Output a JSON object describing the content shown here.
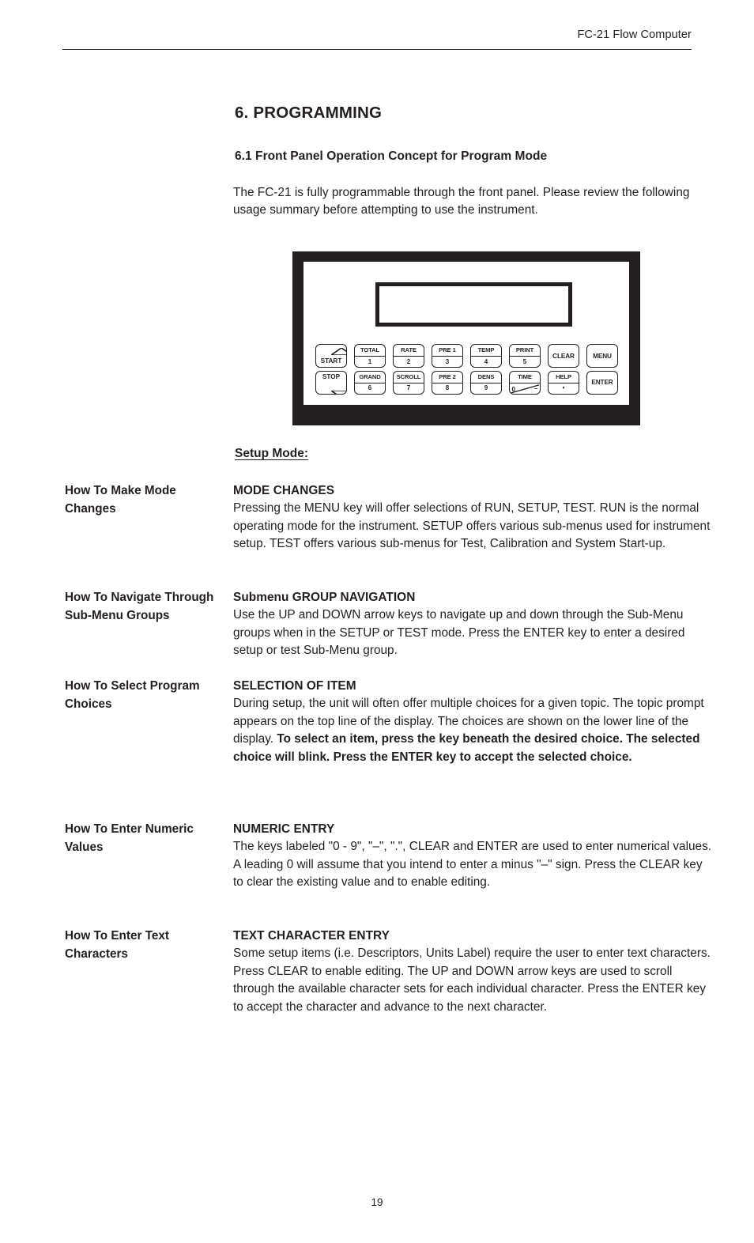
{
  "header": {
    "title": "FC-21 Flow Computer"
  },
  "titles": {
    "chapter": "6. PROGRAMMING",
    "section": "6.1 Front Panel Operation Concept for Program Mode",
    "intro": "The FC-21 is fully programmable through the front panel.  Please review the following usage summary before attempting to use  the instrument.",
    "setup_mode": "Setup Mode:"
  },
  "panel": {
    "display_value": "",
    "keys_row1": [
      {
        "type": "arrow-up",
        "label": "START",
        "sub": ""
      },
      {
        "type": "dual",
        "label": "TOTAL",
        "sub": "1"
      },
      {
        "type": "dual",
        "label": "RATE",
        "sub": "2"
      },
      {
        "type": "dual",
        "label": "PRE 1",
        "sub": "3"
      },
      {
        "type": "dual",
        "label": "TEMP",
        "sub": "4"
      },
      {
        "type": "dual",
        "label": "PRINT",
        "sub": "5"
      },
      {
        "type": "plain",
        "label": "CLEAR",
        "sub": ""
      },
      {
        "type": "plain",
        "label": "MENU",
        "sub": ""
      }
    ],
    "keys_row2": [
      {
        "type": "arrow-down",
        "label": "STOP",
        "sub": ""
      },
      {
        "type": "dual",
        "label": "GRAND",
        "sub": "6"
      },
      {
        "type": "dual",
        "label": "SCROLL",
        "sub": "7"
      },
      {
        "type": "dual",
        "label": "PRE 2",
        "sub": "8"
      },
      {
        "type": "dual",
        "label": "DENS",
        "sub": "9"
      },
      {
        "type": "time",
        "label": "TIME",
        "sub": "0",
        "sub2": "–"
      },
      {
        "type": "dual",
        "label": "HELP",
        "sub": "•"
      },
      {
        "type": "plain",
        "label": "ENTER",
        "sub": ""
      }
    ]
  },
  "sections": [
    {
      "side": "How To Make Mode Changes",
      "heading": "MODE CHANGES",
      "text": "Pressing the MENU key will offer selections of RUN, SETUP, TEST. RUN is the normal operating mode for the instrument.  SETUP offers various sub-menus used for instrument setup.  TEST offers various sub-menus for Test, Calibration and System Start-up.",
      "bold_text": ""
    },
    {
      "side": "How To Navigate Through Sub-Menu Groups",
      "heading": "Submenu GROUP NAVIGATION",
      "text": "Use the UP and DOWN arrow keys to navigate up and down through the Sub-Menu groups when in the SETUP or TEST mode.  Press the ENTER key to enter a desired setup or test Sub-Menu group.",
      "bold_text": ""
    },
    {
      "side": "How To Select Program Choices",
      "heading": "SELECTION OF ITEM",
      "text": "During setup, the unit will often offer multiple choices for a given topic. The topic prompt appears on the top line of the display. The choices are shown on the lower line of the display.",
      "bold_text": "To select an item, press the key beneath the desired choice.  The selected choice will blink.  Press the ENTER key to accept the selected choice."
    },
    {
      "side": "How To Enter Numeric Values",
      "heading": "NUMERIC ENTRY",
      "text": "The keys labeled \"0 - 9\", \"–\", \".\", CLEAR and ENTER are used to enter numerical values.  A leading  0 will assume that you intend to enter a minus \"–\" sign.  Press the CLEAR key to clear the existing value and to enable editing.",
      "bold_text": ""
    },
    {
      "side": "How To Enter Text Characters",
      "heading": "TEXT CHARACTER ENTRY",
      "text": "Some setup items (i.e. Descriptors, Units Label) require the user to enter text characters.  Press CLEAR to enable editing. The UP and DOWN arrow keys are used to scroll through the available character sets for each individual character.  Press the ENTER key to accept the character and advance to the next character.",
      "bold_text": ""
    }
  ],
  "footer": {
    "page_number": "19"
  },
  "colors": {
    "ink": "#231f20",
    "paper": "#ffffff"
  }
}
